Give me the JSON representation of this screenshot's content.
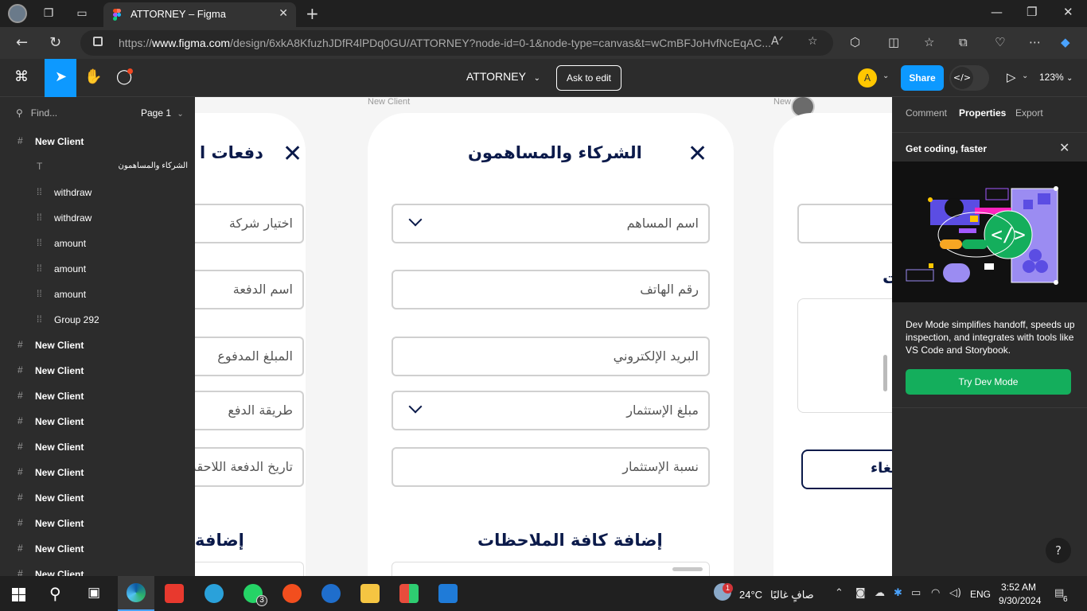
{
  "browser": {
    "tab_title": "ATTORNEY – Figma",
    "url_prefix": "https://",
    "url_domain": "www.figma.com",
    "url_rest": "/design/6xkA8KfuzhJDfR4lPDq0GU/ATTORNEY?node-id=0-1&node-type=canvas&t=wCmBFJoHvfNcEqAC..."
  },
  "figma_toolbar": {
    "document_name": "ATTORNEY",
    "ask_to_edit": "Ask to edit",
    "avatar_letter": "A",
    "share": "Share",
    "zoom": "123%"
  },
  "layers_panel": {
    "find_placeholder": "Find...",
    "page": "Page 1",
    "layers": [
      {
        "name": "New Client",
        "kind": "frame"
      },
      {
        "name": "الشركاء والمساهمون",
        "kind": "text"
      },
      {
        "name": "withdraw",
        "kind": "group"
      },
      {
        "name": "withdraw",
        "kind": "group"
      },
      {
        "name": "amount",
        "kind": "group"
      },
      {
        "name": "amount",
        "kind": "group"
      },
      {
        "name": "amount",
        "kind": "group"
      },
      {
        "name": "Group 292",
        "kind": "group"
      },
      {
        "name": "New Client",
        "kind": "frame"
      },
      {
        "name": "New Client",
        "kind": "frame"
      },
      {
        "name": "New Client",
        "kind": "frame"
      },
      {
        "name": "New Client",
        "kind": "frame"
      },
      {
        "name": "New Client",
        "kind": "frame"
      },
      {
        "name": "New Client",
        "kind": "frame"
      },
      {
        "name": "New Client",
        "kind": "frame"
      },
      {
        "name": "New Client",
        "kind": "frame"
      },
      {
        "name": "New Client",
        "kind": "frame"
      },
      {
        "name": "New Client",
        "kind": "frame"
      }
    ]
  },
  "canvas": {
    "frame_label_center": "New Client",
    "frame_label_right": "New",
    "left_card": {
      "title": "دفعات ا",
      "fields": [
        "اختيار شركة",
        "اسم الدفعة",
        "المبلغ المدفوع",
        "طريقة الدفع",
        "تاريخ الدفعة اللاحقة"
      ],
      "notes_heading": "إضافة"
    },
    "center_card": {
      "title": "الشركاء والمساهمون",
      "fields": [
        "اسم المساهم",
        "رقم الهاتف",
        "البريد الإلكتروني",
        "مبلغ الإستثمار",
        "نسبة الإستثمار"
      ],
      "notes_heading": "إضافة كافة الملاحظات"
    },
    "right_card": {
      "partial_text": "ت",
      "cancel": "إلغاء"
    }
  },
  "properties_panel": {
    "tabs": [
      "Comment",
      "Properties",
      "Export"
    ],
    "active_tab": "Properties",
    "banner_title": "Get coding, faster",
    "description": "Dev Mode simplifies handoff, speeds up inspection, and integrates with tools like VS Code and Storybook.",
    "try_button": "Try Dev Mode",
    "help": "?"
  },
  "taskbar": {
    "whatsapp_badge": "3",
    "weather_temp": "24°C",
    "weather_text": "صافٍ غالبًا",
    "weather_badge": "1",
    "language": "ENG",
    "time": "3:52 AM",
    "date": "9/30/2024",
    "notifications": "6"
  },
  "colors": {
    "figma_blue": "#0d99ff",
    "dev_green": "#14ae5c",
    "heading_navy": "#0b1a4a"
  }
}
